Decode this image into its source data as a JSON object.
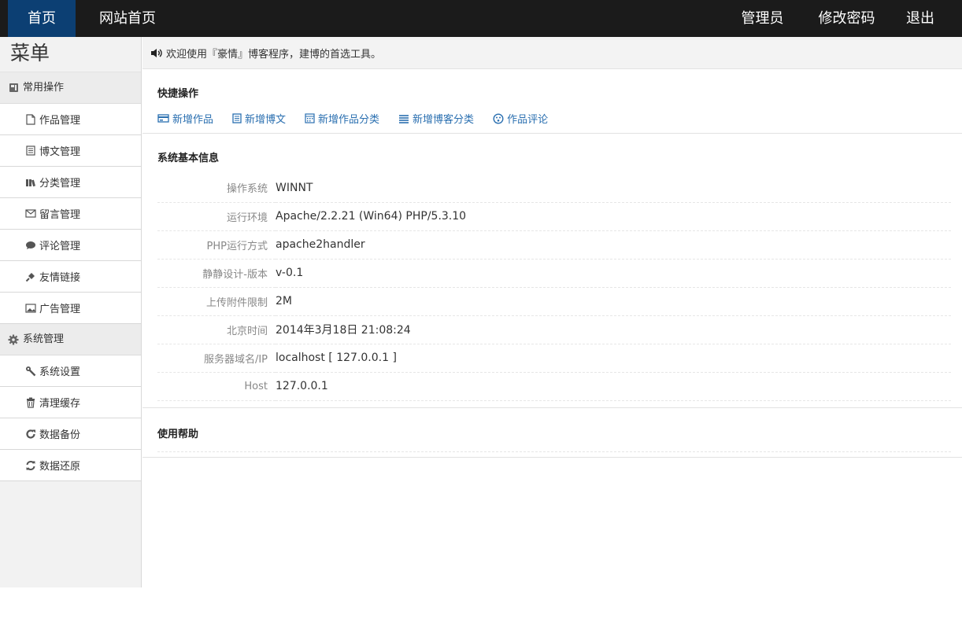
{
  "topnav": {
    "home": "首页",
    "site_home": "网站首页",
    "admin": "管理员",
    "change_password": "修改密码",
    "logout": "退出"
  },
  "sidebar": {
    "title": "菜单",
    "groups": [
      {
        "label": "常用操作",
        "items": [
          "作品管理",
          "博文管理",
          "分类管理",
          "留言管理",
          "评论管理",
          "友情链接",
          "广告管理"
        ]
      },
      {
        "label": "系统管理",
        "items": [
          "系统设置",
          "清理缓存",
          "数据备份",
          "数据还原"
        ]
      }
    ]
  },
  "welcome": "欢迎使用『豪情』博客程序，建博的首选工具。",
  "quick": {
    "title": "快捷操作",
    "links": [
      "新增作品",
      "新增博文",
      "新增作品分类",
      "新增博客分类",
      "作品评论"
    ]
  },
  "sysinfo": {
    "title": "系统基本信息",
    "rows": [
      {
        "k": "操作系统",
        "v": "WINNT"
      },
      {
        "k": "运行环境",
        "v": "Apache/2.2.21 (Win64) PHP/5.3.10"
      },
      {
        "k": "PHP运行方式",
        "v": "apache2handler"
      },
      {
        "k": "静静设计-版本",
        "v": "v-0.1"
      },
      {
        "k": "上传附件限制",
        "v": "2M"
      },
      {
        "k": "北京时间",
        "v": "2014年3月18日 21:08:24"
      },
      {
        "k": "服务器域名/IP",
        "v": "localhost [ 127.0.0.1 ]"
      },
      {
        "k": "Host",
        "v": "127.0.0.1"
      }
    ]
  },
  "help": {
    "title": "使用帮助"
  },
  "colors": {
    "topbar": "#1b1b1b",
    "active_tab": "#0c3f73",
    "link": "#2a6fb0"
  }
}
